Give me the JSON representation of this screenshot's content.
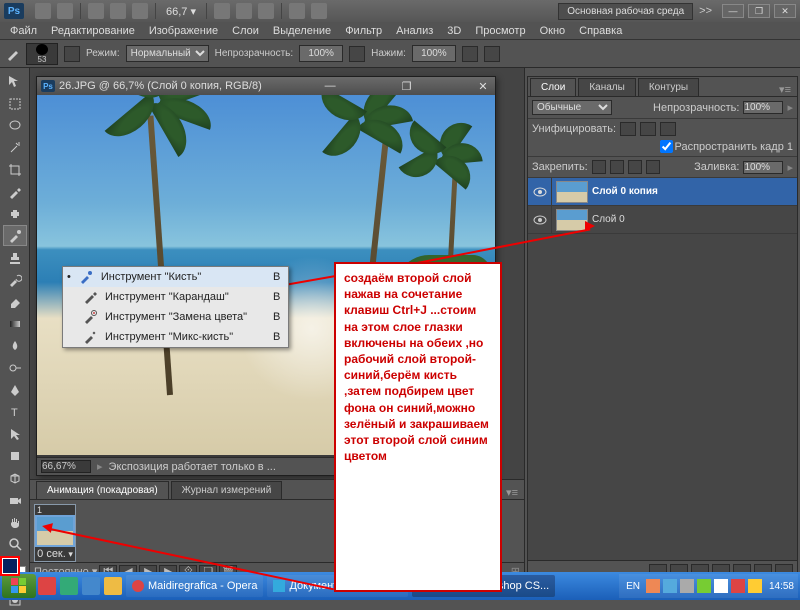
{
  "app": {
    "logo": "Ps",
    "zoom": "66,7"
  },
  "workspace": {
    "label": "Основная рабочая среда",
    "expand": ">>"
  },
  "win_controls": {
    "min": "—",
    "max": "❐",
    "close": "✕"
  },
  "menu": [
    "Файл",
    "Редактирование",
    "Изображение",
    "Слои",
    "Выделение",
    "Фильтр",
    "Анализ",
    "3D",
    "Просмотр",
    "Окно",
    "Справка"
  ],
  "options": {
    "brush_size": "53",
    "mode_label": "Режим:",
    "mode_value": "Нормальный",
    "opacity_label": "Непрозрачность:",
    "opacity_value": "100%",
    "flow_label": "Нажим:",
    "flow_value": "100%"
  },
  "document": {
    "title": "26.JPG @ 66,7% (Слой 0 копия, RGB/8)",
    "status_zoom": "66,67%",
    "status_text": "Экспозиция работает только в ..."
  },
  "brush_flyout": {
    "items": [
      {
        "label": "Инструмент \"Кисть\"",
        "key": "B",
        "selected": true
      },
      {
        "label": "Инструмент \"Карандаш\"",
        "key": "B",
        "selected": false
      },
      {
        "label": "Инструмент \"Замена цвета\"",
        "key": "B",
        "selected": false
      },
      {
        "label": "Инструмент \"Микс-кисть\"",
        "key": "B",
        "selected": false
      }
    ]
  },
  "annotation": "создаём  второй слой нажав на сочетание  клавиш Ctrl+J   ...стоим на этом слое глазки включены на обеих ,но рабочий слой второй-синий,берём кисть ,затем подбирем цвет фона он синий,можно зелёный и закрашиваем этот второй слой синим цветом",
  "animation": {
    "tab1": "Анимация (покадровая)",
    "tab2": "Журнал измерений",
    "frame_num": "1",
    "frame_time": "0 сек.",
    "loop": "Постоянно"
  },
  "layers_panel": {
    "tabs": [
      "Слои",
      "Каналы",
      "Контуры"
    ],
    "blend_value": "Обычные",
    "opacity_label": "Непрозрачность:",
    "opacity_value": "100%",
    "unify_label": "Унифицировать:",
    "propagate_label": "Распространить кадр 1",
    "lock_label": "Закрепить:",
    "fill_label": "Заливка:",
    "fill_value": "100%",
    "layers": [
      {
        "name": "Слой 0 копия",
        "selected": true
      },
      {
        "name": "Слой 0",
        "selected": false
      }
    ]
  },
  "taskbar": {
    "items": [
      {
        "label": "Maidiregrafica - Opera",
        "active": false
      },
      {
        "label": "Документ 1WordPad...",
        "active": false
      },
      {
        "label": "Adobe Photoshop CS...",
        "active": true
      }
    ],
    "lang": "EN",
    "time": "14:58"
  }
}
